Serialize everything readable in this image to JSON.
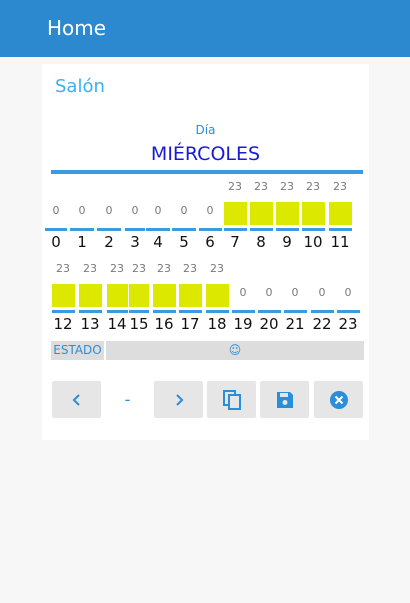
{
  "app": {
    "title": "Home"
  },
  "card": {
    "title": "Salón",
    "day_label": "Día",
    "day_value": "MIÉRCOLES",
    "row1": {
      "hours": [
        "0",
        "1",
        "2",
        "3",
        "4",
        "5",
        "6",
        "7",
        "8",
        "9",
        "10",
        "11"
      ],
      "values": [
        "0",
        "0",
        "0",
        "0",
        "0",
        "0",
        "0",
        "23",
        "23",
        "23",
        "23",
        "23"
      ]
    },
    "row2": {
      "hours": [
        "12",
        "13",
        "14",
        "15",
        "16",
        "17",
        "18",
        "19",
        "20",
        "21",
        "22",
        "23"
      ],
      "values": [
        "23",
        "23",
        "23",
        "23",
        "23",
        "23",
        "23",
        "0",
        "0",
        "0",
        "0",
        "0"
      ]
    },
    "estado_label": "ESTADO",
    "estado_value": "☺",
    "nav": {
      "separator": "-"
    }
  },
  "colors": {
    "accent": "#2d89cf",
    "bar": "#dde800",
    "day": "#1a1ad6"
  },
  "icons": [
    "chevron-left-icon",
    "chevron-right-icon",
    "copy-icon",
    "save-icon",
    "cancel-icon"
  ]
}
